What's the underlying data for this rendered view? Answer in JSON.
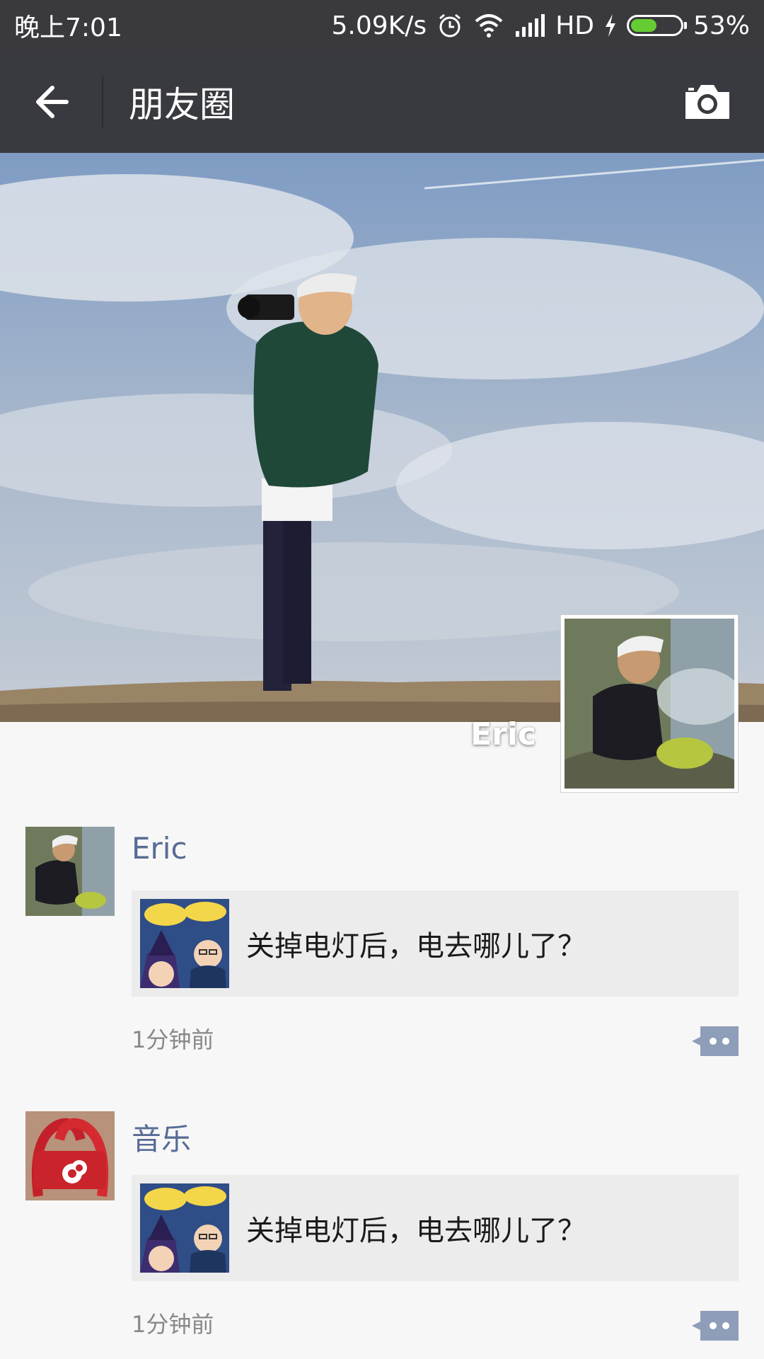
{
  "status_bar": {
    "time": "晚上7:01",
    "speed": "5.09K/s",
    "network": "HD",
    "battery": "53%",
    "battery_level": 0.53
  },
  "nav": {
    "title": "朋友圈"
  },
  "cover": {
    "name": "Eric"
  },
  "posts": [
    {
      "author": "Eric",
      "text": "关掉电灯后，电去哪儿了？",
      "time": "1分钟前"
    },
    {
      "author": "音乐",
      "text": "关掉电灯后，电去哪儿了？",
      "time": "1分钟前"
    }
  ],
  "colors": {
    "nav_bg": "#393a3f",
    "name_link": "#576b95",
    "battery": "#66cc33"
  }
}
